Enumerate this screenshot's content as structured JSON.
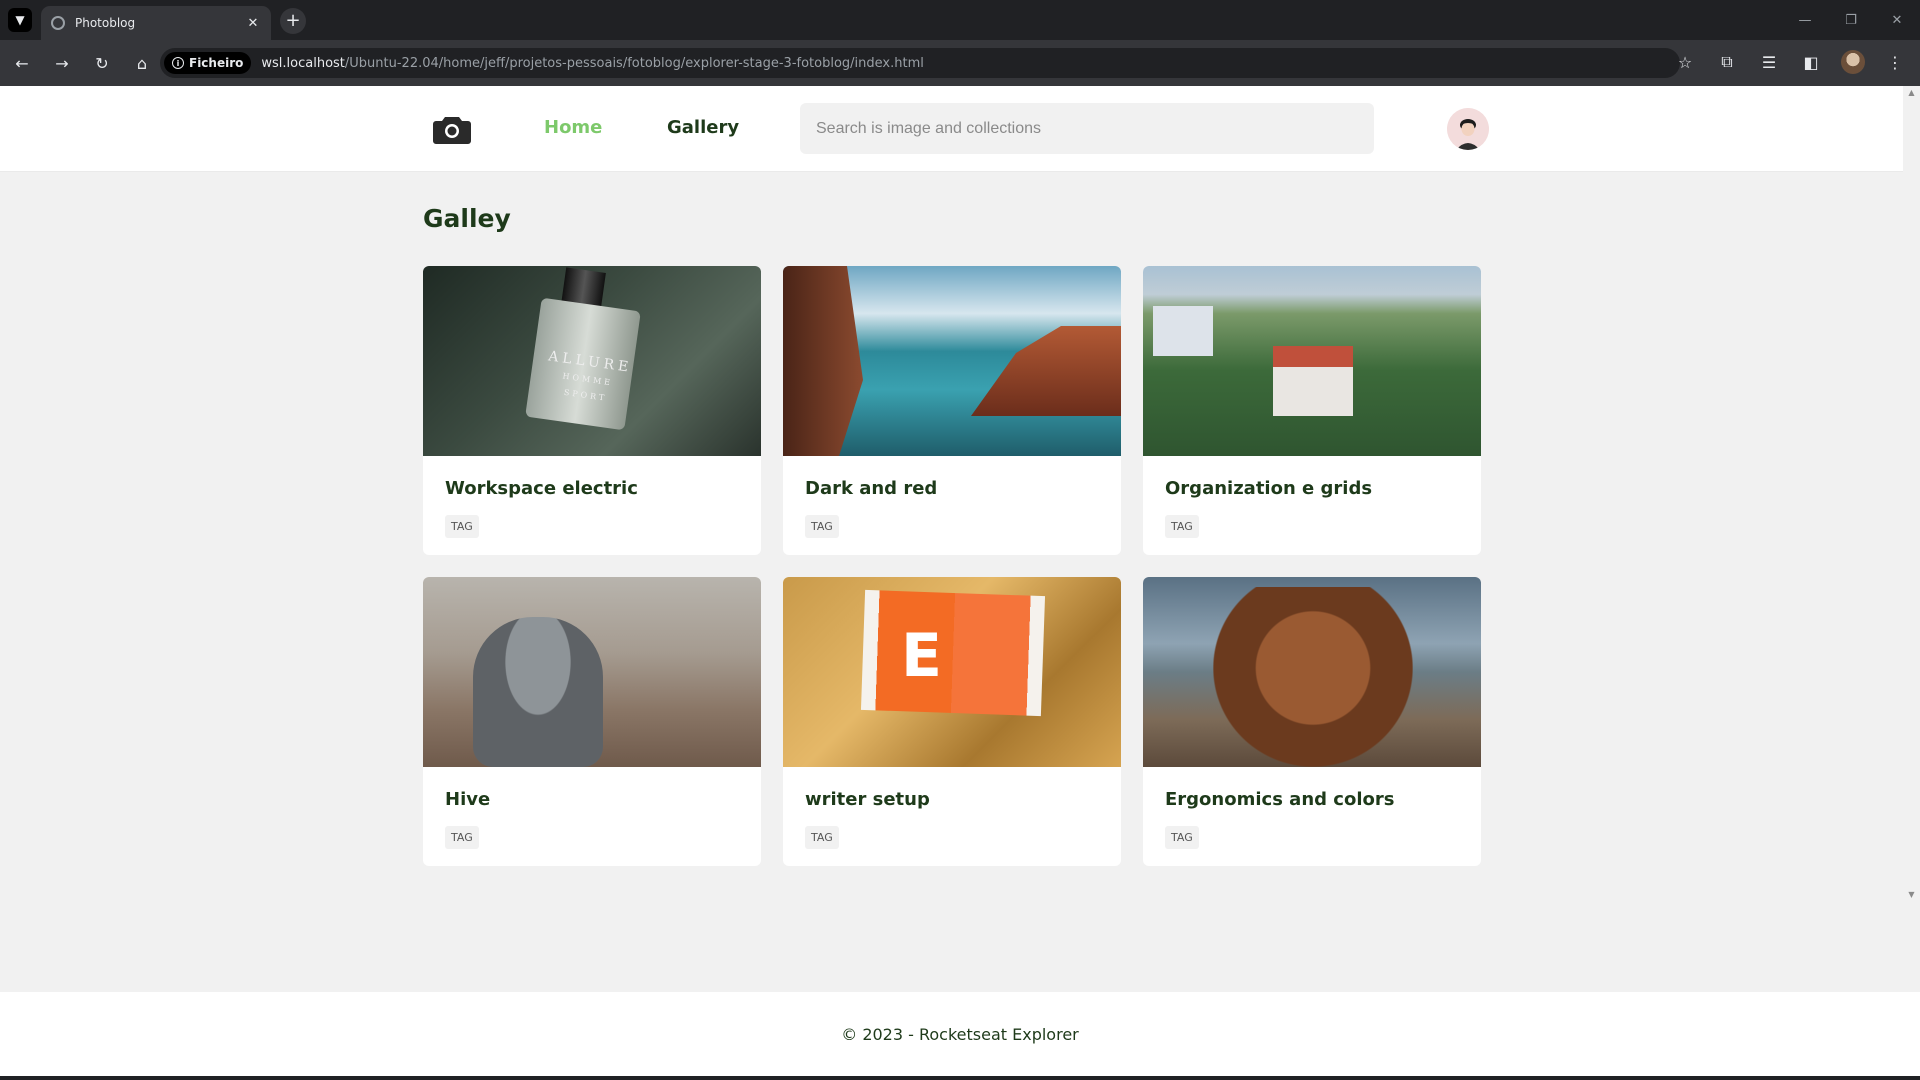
{
  "browser": {
    "tab_title": "Photoblog",
    "new_tab_symbol": "+",
    "security_label": "Ficheiro",
    "url_host": "wsl.localhost",
    "url_path": "/Ubuntu-22.04/home/jeff/projetos-pessoais/fotoblog/explorer-stage-3-fotoblog/index.html",
    "icons": [
      "back-icon",
      "forward-icon",
      "reload-icon",
      "home-icon",
      "star-icon",
      "extensions-icon",
      "media-icon",
      "sidepanel-icon",
      "profile-avatar",
      "menu-icon"
    ]
  },
  "header": {
    "nav": {
      "home": "Home",
      "gallery": "Gallery"
    },
    "search_placeholder": "Search is image and collections",
    "active_color": "#7dc96b"
  },
  "main": {
    "title": "Galley",
    "cards": [
      {
        "title": "Workspace electric",
        "tag": "TAG"
      },
      {
        "title": "Dark and red",
        "tag": "TAG"
      },
      {
        "title": "Organization e grids",
        "tag": "TAG"
      },
      {
        "title": "Hive",
        "tag": "TAG"
      },
      {
        "title": "writer setup",
        "tag": "TAG"
      },
      {
        "title": "Ergonomics and colors",
        "tag": "TAG"
      }
    ],
    "image_labels": {
      "perfume_brand": "ALLURE",
      "perfume_sub": "HOMME",
      "perfume_line": "SPORT",
      "book_letter": "E"
    }
  },
  "footer": {
    "text": "© 2023 - Rocketseat Explorer"
  },
  "colors": {
    "title": "#1e3a1a",
    "page_bg": "#f1f1f1",
    "chrome_dark": "#202124"
  }
}
